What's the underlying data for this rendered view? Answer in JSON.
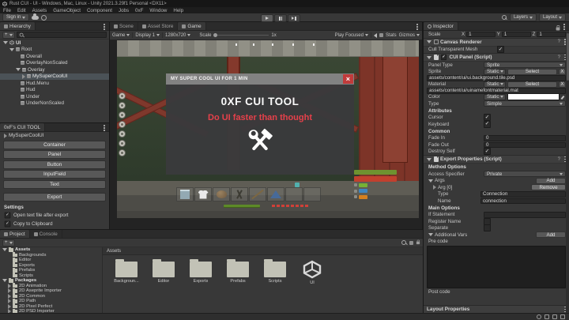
{
  "window": {
    "title": "Rust CUI - UI - Windows, Mac, Linux - Unity 2021.3.29f1 Personal <DX11>"
  },
  "menu": {
    "items": [
      "File",
      "Edit",
      "Assets",
      "GameObject",
      "Component",
      "Jobs",
      "0xF",
      "Window",
      "Help"
    ]
  },
  "toolbar": {
    "sign_in": "Sign in",
    "layers": "Layers",
    "layout": "Layout"
  },
  "hierarchy": {
    "tab": "Hierarchy",
    "add_button": "+",
    "items": [
      {
        "label": "UI"
      },
      {
        "label": "Root"
      },
      {
        "label": "Overall"
      },
      {
        "label": "OverlayNonScaled"
      },
      {
        "label": "Overlay"
      },
      {
        "label": "MySuperCoolUI"
      },
      {
        "label": "Hud.Menu"
      },
      {
        "label": "Hud"
      },
      {
        "label": "Under"
      },
      {
        "label": "UnderNonScaled"
      }
    ]
  },
  "cui_tool": {
    "tab": "0xF's CUI TOOL",
    "selected_object": "MySuperCoolUI",
    "buttons": [
      "Container",
      "Panel",
      "Button",
      "InputField",
      "Text"
    ],
    "export_button": "Export",
    "settings_title": "Settings",
    "options": [
      {
        "label": "Open text file after export",
        "checked": true
      },
      {
        "label": "Copy to Clipboard",
        "checked": true
      }
    ]
  },
  "game": {
    "tabs": [
      "Scene",
      "Asset Store",
      "Game"
    ],
    "active_tab": "Game",
    "controls": {
      "view": "Game",
      "display": "Display 1",
      "resolution": "1280x720",
      "scale_label": "Scale",
      "scale_value": "1x",
      "play_focused": "Play Focused",
      "stats": "Stats",
      "gizmos": "Gizmos"
    },
    "dialog": {
      "title": "MY SUPER COOL UI FOR 1 MIN",
      "heading": "0XF CUI TOOL",
      "subheading": "Do UI faster than thought",
      "close": "×"
    },
    "hud": {
      "hotbar_items": [
        "blueprint",
        "shirt",
        "rock",
        "tools",
        "spear",
        "tent",
        "empty",
        "empty"
      ],
      "vitals_colors": {
        "green": "#6f9230",
        "red": "#c2402e",
        "blue": "#3e86c0",
        "orange": "#d5801f"
      }
    }
  },
  "inspector": {
    "tab": "Inspector",
    "scale": {
      "label": "Scale",
      "x_label": "X",
      "x": "1",
      "y_label": "Y",
      "y": "1",
      "z_label": "Z",
      "z": "1"
    },
    "canvas_renderer": {
      "title": "Canvas Renderer",
      "cull": "Cull Transparent Mesh"
    },
    "cui_panel": {
      "title": "CUI Panel (Script)",
      "panel_type_label": "Panel Type",
      "panel_type": "Sprite",
      "sprite_label": "Sprite",
      "material_label": "Material",
      "color_label": "Color",
      "type_label": "Type",
      "type_value": "Simple",
      "static": "Static",
      "select": "Select",
      "clear": "X",
      "sprite_path": "assets/content/ui/ui.background.tile.psd",
      "material_path": "assets/content/ui/uinamefontmaterial.mat",
      "attributes_title": "Attributes",
      "cursor": "Cursor",
      "keyboard": "Keyboard",
      "common_title": "Common",
      "fade_in": "Fade In",
      "fade_in_value": "0",
      "fade_out": "Fade Out",
      "fade_out_value": "0",
      "destroy_self": "Destroy Self"
    },
    "export_props": {
      "title": "Export Properties (Script)",
      "method_options": "Method Options",
      "access_label": "Access Specifier",
      "access_value": "Private",
      "args": "Args",
      "add": "Add",
      "arg0": "Arg [0]",
      "remove": "Remove",
      "type_label": "Type",
      "type_value": "Connection",
      "name_label": "Name",
      "name_value": "connection",
      "main_options": "Main Options",
      "if_statement": "If Statement",
      "register_name": "Register Name",
      "separate": "Separate",
      "additional_vars": "Additional Vars",
      "pre_code": "Pre code",
      "post_code": "Post code"
    },
    "layout_properties": "Layout Properties"
  },
  "project": {
    "tabs": [
      "Project",
      "Console"
    ],
    "active_tab": "Project",
    "add_button": "+",
    "breadcrumb": "Assets",
    "tree": [
      {
        "label": "Assets"
      },
      {
        "label": "Backgrounds"
      },
      {
        "label": "Editor"
      },
      {
        "label": "Exports"
      },
      {
        "label": "Prefabs"
      },
      {
        "label": "Scripts"
      },
      {
        "label": "Packages"
      },
      {
        "label": "2D Animation"
      },
      {
        "label": "2D Aseprite Importer"
      },
      {
        "label": "2D Common"
      },
      {
        "label": "2D Path"
      },
      {
        "label": "2D Pixel Perfect"
      },
      {
        "label": "2D PSD Importer"
      }
    ],
    "grid": [
      {
        "label": "Backgroun..."
      },
      {
        "label": "Editor"
      },
      {
        "label": "Exports"
      },
      {
        "label": "Prefabs"
      },
      {
        "label": "Scripts"
      },
      {
        "label": "UI"
      }
    ]
  }
}
